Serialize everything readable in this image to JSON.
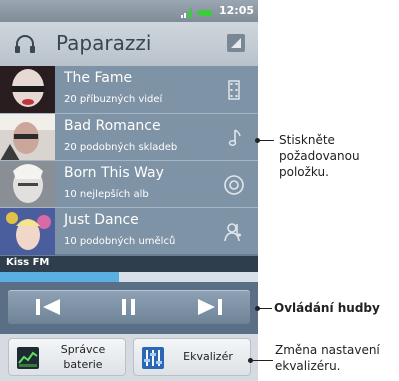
{
  "status_bar": {
    "time": "12:05"
  },
  "title_bar": {
    "title": "Paparazzi"
  },
  "list": [
    {
      "title": "The Fame",
      "subtitle": "20 příbuzných videí",
      "icon": "film-icon"
    },
    {
      "title": "Bad Romance",
      "subtitle": "20 podobných skladeb",
      "icon": "music-note-icon"
    },
    {
      "title": "Born This Way",
      "subtitle": "10 nejlepších alb",
      "icon": "disc-icon"
    },
    {
      "title": "Just Dance",
      "subtitle": "10 podobných umělců",
      "icon": "artist-icon"
    }
  ],
  "station": {
    "label": "Kiss FM"
  },
  "playback": {
    "progress_fraction": 0.46
  },
  "controls": {
    "prev_icon": "skip-previous-icon",
    "pause_icon": "pause-icon",
    "next_icon": "skip-next-icon"
  },
  "bottom_buttons": {
    "battery": {
      "line1": "Správce",
      "line2": "baterie"
    },
    "eq": {
      "label": "Ekvalizér"
    }
  },
  "callouts": {
    "select_item": {
      "line1": "Stiskněte",
      "line2": "požadovanou",
      "line3": "položku."
    },
    "music_controls": "Ovládání hudby",
    "eq_change": {
      "line1": "Změna nastavení",
      "line2": "ekvalizéru."
    }
  },
  "colors": {
    "accent": "#5ab0e0",
    "battery": "#3ecb3e"
  }
}
